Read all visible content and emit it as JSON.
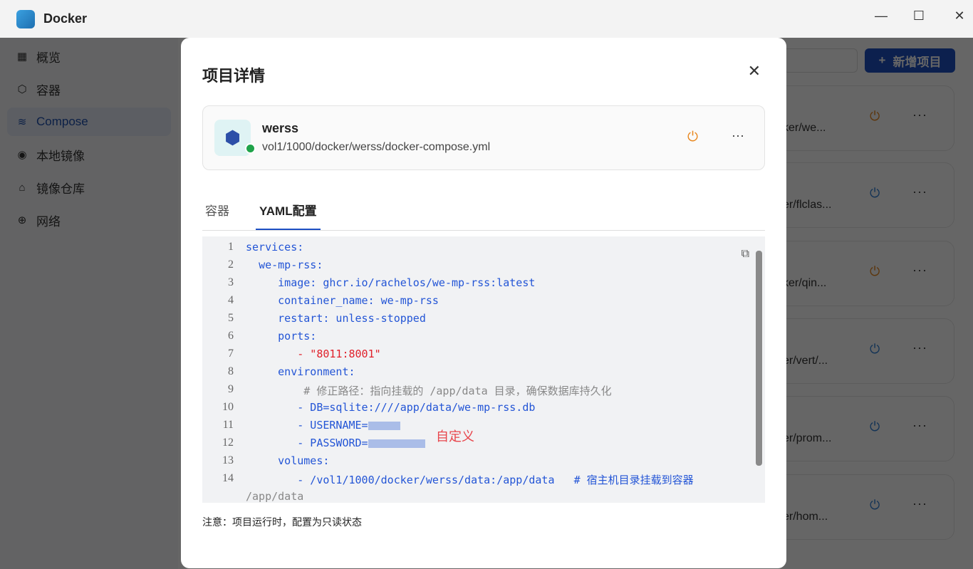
{
  "window": {
    "title": "Docker",
    "minimize": "—",
    "maximize": "☐",
    "close": "✕"
  },
  "sidebar": {
    "items": [
      {
        "icon": "grid-icon",
        "glyph": "▦",
        "label": "概览"
      },
      {
        "icon": "container-icon",
        "glyph": "⬡",
        "label": "容器"
      },
      {
        "icon": "layers-icon",
        "glyph": "≋",
        "label": "Compose"
      },
      {
        "icon": "image-icon",
        "glyph": "◉",
        "label": "本地镜像"
      },
      {
        "icon": "home-icon",
        "glyph": "⌂",
        "label": "镜像仓库"
      },
      {
        "icon": "globe-icon",
        "glyph": "⊕",
        "label": "网络"
      }
    ]
  },
  "toolbar": {
    "add_label": "新增项目",
    "plus": "+"
  },
  "cards": [
    {
      "path": "ker/we...",
      "color": "#e8871e"
    },
    {
      "path": "er/flclas...",
      "color": "#2f7fd6"
    },
    {
      "path": "ker/qin...",
      "color": "#e8871e"
    },
    {
      "path": "er/vert/...",
      "color": "#2f7fd6"
    },
    {
      "path": "er/prom...",
      "color": "#2f7fd6"
    },
    {
      "path": "er/hom...",
      "color": "#2f7fd6"
    }
  ],
  "modal": {
    "title": "项目详情",
    "close": "✕",
    "project": {
      "name": "werss",
      "path": "vol1/1000/docker/werss/docker-compose.yml",
      "status": "running",
      "power": "⏻",
      "more": "···"
    },
    "tabs": [
      {
        "label": "容器"
      },
      {
        "label": "YAML配置"
      }
    ],
    "code": [
      {
        "n": "1",
        "indent": "",
        "text": "services:",
        "cls": ""
      },
      {
        "n": "2",
        "indent": "  ",
        "text": "we-mp-rss:",
        "cls": ""
      },
      {
        "n": "3",
        "indent": "     ",
        "text": "image: ghcr.io/rachelos/we-mp-rss:latest",
        "cls": ""
      },
      {
        "n": "4",
        "indent": "     ",
        "text": "container_name: we-mp-rss",
        "cls": ""
      },
      {
        "n": "5",
        "indent": "     ",
        "text": "restart: unless-stopped",
        "cls": ""
      },
      {
        "n": "6",
        "indent": "     ",
        "text": "ports:",
        "cls": ""
      },
      {
        "n": "7",
        "indent": "        ",
        "text": "- \"8011:8001\"",
        "cls": "red"
      },
      {
        "n": "8",
        "indent": "     ",
        "text": "environment:",
        "cls": ""
      },
      {
        "n": "9",
        "indent": "         ",
        "text": "# 修正路径：指向挂载的 /app/data 目录，确保数据库持久化",
        "cls": "cmt"
      },
      {
        "n": "10",
        "indent": "        ",
        "text": "- DB=sqlite:////app/data/we-mp-rss.db",
        "cls": ""
      },
      {
        "n": "11",
        "indent": "        ",
        "text": "- USERNAME=",
        "cls": ""
      },
      {
        "n": "12",
        "indent": "        ",
        "text": "- PASSWORD=",
        "cls": ""
      },
      {
        "n": "13",
        "indent": "     ",
        "text": "volumes:",
        "cls": ""
      },
      {
        "n": "14",
        "indent": "        ",
        "text": "- /vol1/1000/docker/werss/data:/app/data   # 宿主机目录挂载到容器",
        "cls": ""
      },
      {
        "n": "",
        "indent": "",
        "text": "/app/data",
        "cls": "cmt"
      }
    ],
    "annotation": "自定义",
    "note": "注意：项目运行时，配置为只读状态"
  }
}
